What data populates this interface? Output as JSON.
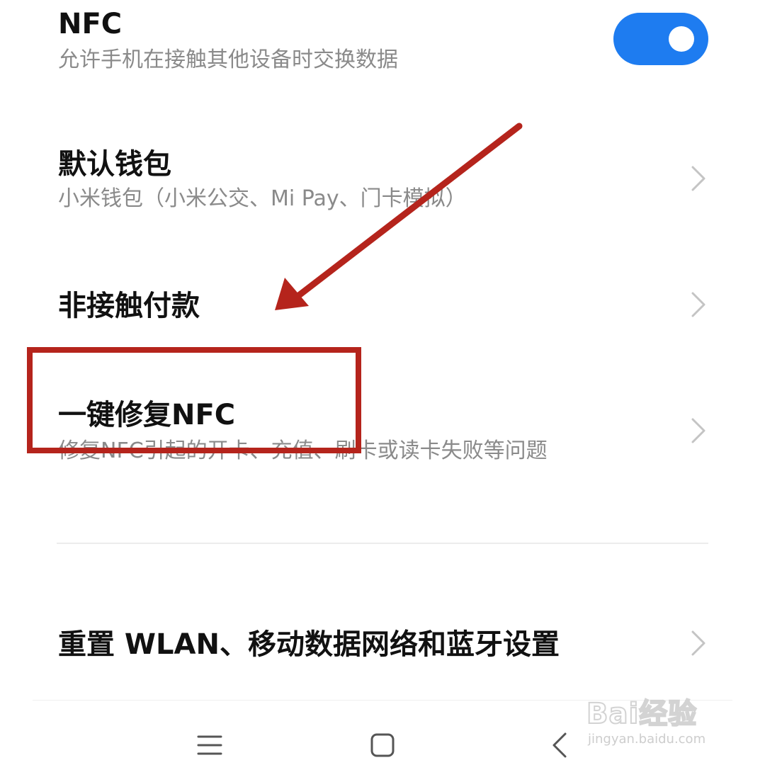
{
  "settings": {
    "nfc": {
      "title": "NFC",
      "subtitle": "允许手机在接触其他设备时交换数据",
      "toggle_on": true
    },
    "default_wallet": {
      "title": "默认钱包",
      "subtitle": "小米钱包（小米公交、Mi Pay、门卡模拟）"
    },
    "contactless_payment": {
      "title": "非接触付款"
    },
    "repair_nfc": {
      "title": "一键修复NFC",
      "subtitle": "修复NFC引起的开卡、充值、刷卡或读卡失败等问题"
    },
    "reset_network": {
      "title": "重置 WLAN、移动数据网络和蓝牙设置"
    }
  },
  "nav": {
    "icons": [
      "menu-icon",
      "home-icon",
      "back-icon"
    ]
  },
  "annotation": {
    "color": "#b5241c"
  },
  "watermark": {
    "logo": "Bai经验",
    "url": "jingyan.baidu.com"
  },
  "colors": {
    "toggle_on": "#1e7cf0",
    "subtitle": "#8a8a8a"
  }
}
